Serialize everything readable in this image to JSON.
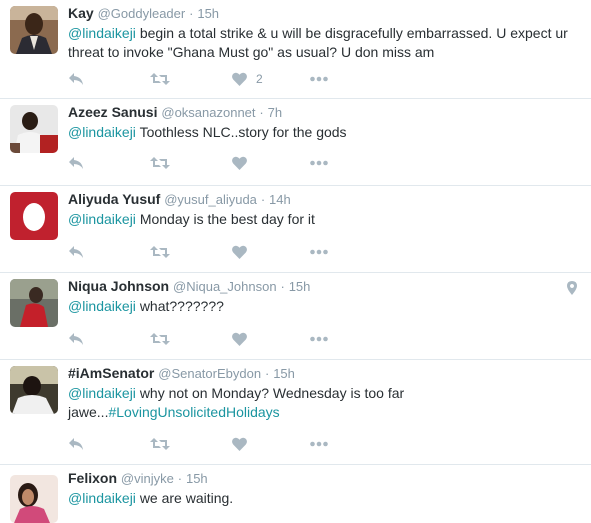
{
  "tweets": [
    {
      "fullname": "Kay",
      "username": "@Goddyleader",
      "time": "15h",
      "mention": "@lindaikeji",
      "text": "begin a total strike & u will be disgracefully embarrassed. U expect ur threat to invoke \"Ghana Must go\" as usual? U don miss am",
      "like_count": "2"
    },
    {
      "fullname": "Azeez Sanusi",
      "username": "@oksanazonnet",
      "time": "7h",
      "mention": "@lindaikeji",
      "text": "Toothless NLC..story for the gods"
    },
    {
      "fullname": "Aliyuda Yusuf",
      "username": "@yusuf_aliyuda",
      "time": "14h",
      "mention": "@lindaikeji",
      "text": "Monday is the best day for it"
    },
    {
      "fullname": "Niqua Johnson",
      "username": "@Niqua_Johnson",
      "time": "15h",
      "mention": "@lindaikeji",
      "text": "what???????"
    },
    {
      "fullname": "#iAmSenator",
      "username": "@SenatorEbydon",
      "time": "15h",
      "mention": "@lindaikeji",
      "text": "why not on Monday? Wednesday is too far jawe...",
      "hashtag": "#LovingUnsolicitedHolidays"
    },
    {
      "fullname": "Felixon",
      "username": "@vinjyke",
      "time": "15h",
      "mention": "@lindaikeji",
      "text": "we are waiting."
    }
  ],
  "colors": {
    "link": "#1b95a0",
    "muted": "#8899a6",
    "icon": "#aab8c2",
    "divider": "#e1e8ed"
  },
  "icons": [
    "reply-icon",
    "retweet-icon",
    "like-icon",
    "more-icon",
    "location-icon"
  ]
}
